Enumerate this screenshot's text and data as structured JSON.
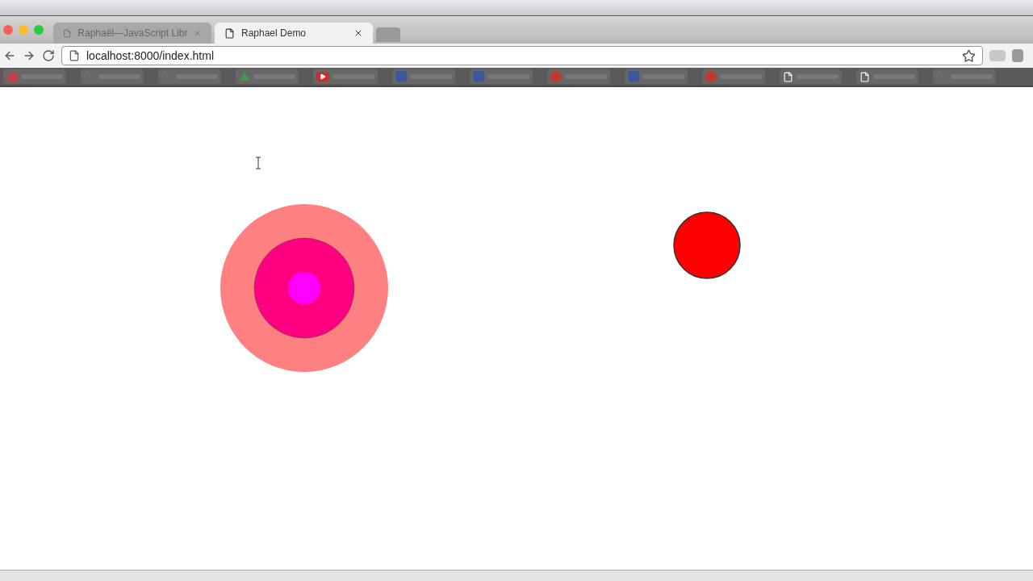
{
  "tabs": [
    {
      "title": "Raphaël—JavaScript Libr",
      "selected": false
    },
    {
      "title": "Raphael Demo",
      "selected": true
    }
  ],
  "address_bar": {
    "value": "localhost:8000/index.html"
  },
  "bookmarks": [
    {
      "kind": "grid"
    },
    {
      "kind": "folder"
    },
    {
      "kind": "folder"
    },
    {
      "kind": "drive"
    },
    {
      "kind": "play"
    },
    {
      "kind": "letter"
    },
    {
      "kind": "letter"
    },
    {
      "kind": "circle"
    },
    {
      "kind": "letter"
    },
    {
      "kind": "circle"
    },
    {
      "kind": "page"
    },
    {
      "kind": "page"
    },
    {
      "kind": "folder"
    }
  ],
  "canvas": {
    "circles": [
      {
        "color": "#ff8080"
      },
      {
        "color": "#ff0080"
      },
      {
        "color": "#ff00ff"
      },
      {
        "color": "#ff0000"
      }
    ]
  }
}
